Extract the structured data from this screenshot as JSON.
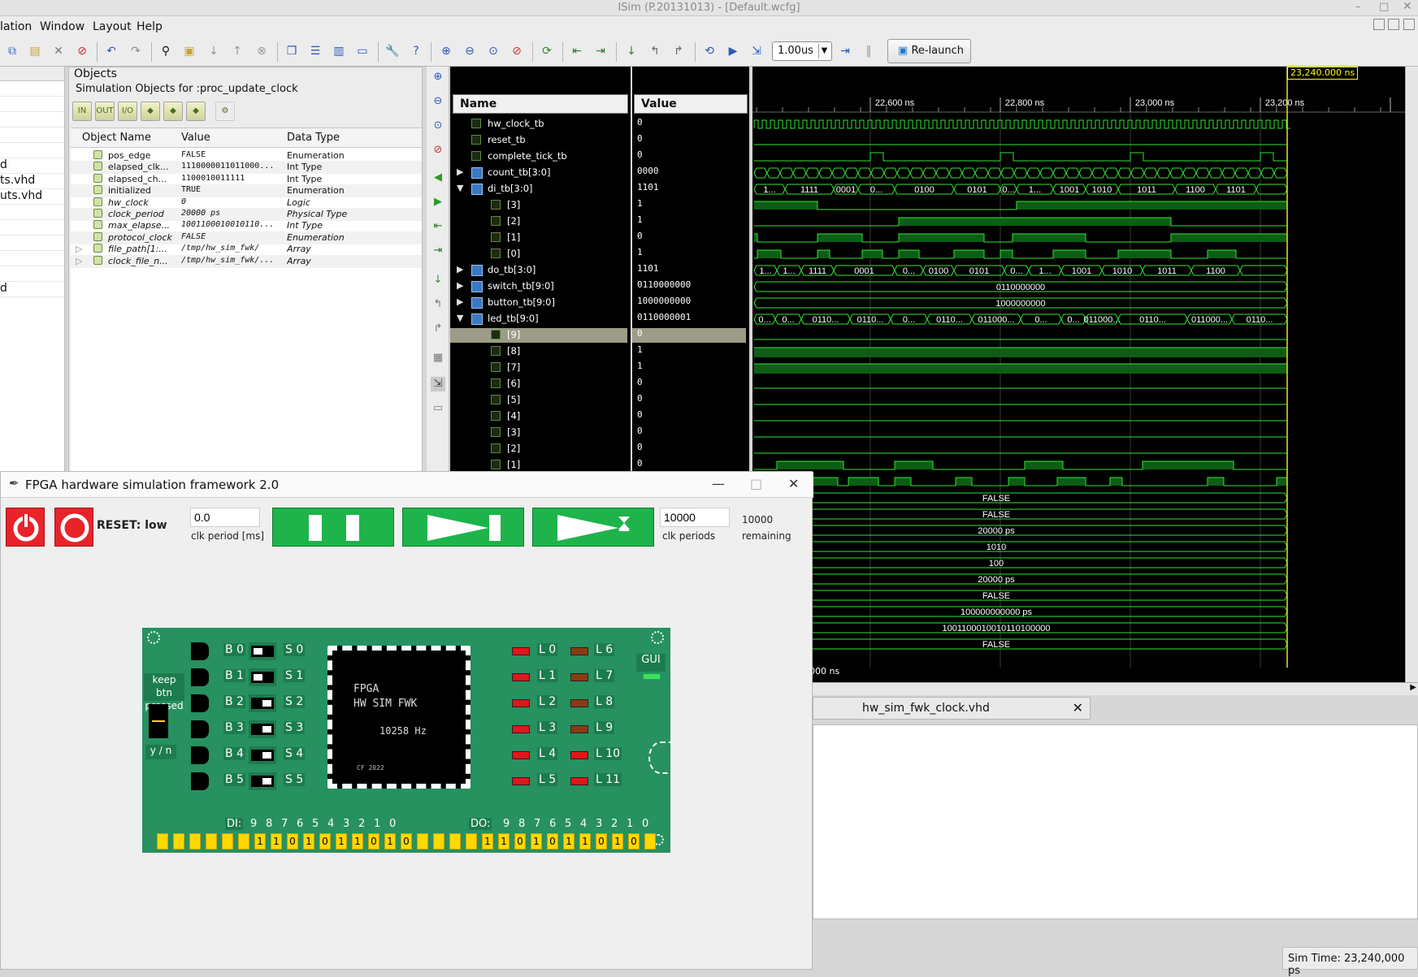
{
  "window": {
    "title": "ISim (P.20131013) - [Default.wcfg]"
  },
  "menu": [
    "lation",
    "Window",
    "Layout",
    "Help"
  ],
  "toolbar": {
    "zoom": "1.00us",
    "relaunch": "Re-launch"
  },
  "left_strip": [
    "",
    "",
    "",
    "",
    "",
    "d",
    "ts.vhd",
    "uts.vhd",
    "",
    "",
    "",
    "",
    "",
    "d"
  ],
  "objects": {
    "title": "Objects",
    "subtitle": "Simulation Objects for :proc_update_clock",
    "columns": [
      "Object Name",
      "Value",
      "Data Type"
    ],
    "rows": [
      {
        "name": "pos_edge",
        "value": "FALSE",
        "type": "Enumeration",
        "italic": false
      },
      {
        "name": "elapsed_clk...",
        "value": "1110000011011000...",
        "type": "Int Type",
        "italic": false
      },
      {
        "name": "elapsed_ch...",
        "value": "1100010011111",
        "type": "Int Type",
        "italic": false
      },
      {
        "name": "initialized",
        "value": "TRUE",
        "type": "Enumeration",
        "italic": false
      },
      {
        "name": "hw_clock",
        "value": "0",
        "type": "Logic",
        "italic": true
      },
      {
        "name": "clock_period",
        "value": "20000 ps",
        "type": "Physical Type",
        "italic": true
      },
      {
        "name": "max_elapse...",
        "value": "1001100010010110...",
        "type": "Int Type",
        "italic": true
      },
      {
        "name": "protocol_clock",
        "value": "FALSE",
        "type": "Enumeration",
        "italic": true
      },
      {
        "name": "file_path[1:...",
        "value": "/tmp/hw_sim_fwk/",
        "type": "Array",
        "italic": true
      },
      {
        "name": "clock_file_n...",
        "value": "/tmp/hw_sim_fwk/...",
        "type": "Array",
        "italic": true
      }
    ]
  },
  "wave": {
    "name_header": "Name",
    "value_header": "Value",
    "signals": [
      {
        "name": "hw_clock_tb",
        "value": "0",
        "indent": 0,
        "tri": ""
      },
      {
        "name": "reset_tb",
        "value": "0",
        "indent": 0,
        "tri": ""
      },
      {
        "name": "complete_tick_tb",
        "value": "0",
        "indent": 0,
        "tri": ""
      },
      {
        "name": "count_tb[3:0]",
        "value": "0000",
        "indent": 0,
        "tri": "▶"
      },
      {
        "name": "di_tb[3:0]",
        "value": "1101",
        "indent": 0,
        "tri": "▼"
      },
      {
        "name": "[3]",
        "value": "1",
        "indent": 1,
        "tri": ""
      },
      {
        "name": "[2]",
        "value": "1",
        "indent": 1,
        "tri": ""
      },
      {
        "name": "[1]",
        "value": "0",
        "indent": 1,
        "tri": ""
      },
      {
        "name": "[0]",
        "value": "1",
        "indent": 1,
        "tri": ""
      },
      {
        "name": "do_tb[3:0]",
        "value": "1101",
        "indent": 0,
        "tri": "▶"
      },
      {
        "name": "switch_tb[9:0]",
        "value": "0110000000",
        "indent": 0,
        "tri": "▶"
      },
      {
        "name": "button_tb[9:0]",
        "value": "1000000000",
        "indent": 0,
        "tri": "▶"
      },
      {
        "name": "led_tb[9:0]",
        "value": "0110000001",
        "indent": 0,
        "tri": "▼"
      },
      {
        "name": "[9]",
        "value": "0",
        "indent": 1,
        "tri": ""
      },
      {
        "name": "[8]",
        "value": "1",
        "indent": 1,
        "tri": ""
      },
      {
        "name": "[7]",
        "value": "1",
        "indent": 1,
        "tri": ""
      },
      {
        "name": "[6]",
        "value": "0",
        "indent": 1,
        "tri": ""
      },
      {
        "name": "[5]",
        "value": "0",
        "indent": 1,
        "tri": ""
      },
      {
        "name": "[4]",
        "value": "0",
        "indent": 1,
        "tri": ""
      },
      {
        "name": "[3]",
        "value": "0",
        "indent": 1,
        "tri": ""
      },
      {
        "name": "[2]",
        "value": "0",
        "indent": 1,
        "tri": ""
      },
      {
        "name": "[1]",
        "value": "0",
        "indent": 1,
        "tri": ""
      }
    ],
    "time_ticks": [
      "22,600 ns",
      "22,800 ns",
      "23,000 ns",
      "23,200 ns",
      "23,4"
    ],
    "cursor": "23,240.000 ns",
    "bus_labels_count": [
      "1...",
      "1111",
      "0001",
      "0...",
      "0100",
      "0101",
      "0...",
      "1...",
      "1001",
      "1010",
      "1011",
      "1100",
      "1101"
    ],
    "bus_labels_do": [
      "1...",
      "1...",
      "1111",
      "0001",
      "0...",
      "0100",
      "0101",
      "0...",
      "1...",
      "1001",
      "1010",
      "1011",
      "1100"
    ],
    "bus_labels_led": [
      "0...",
      "0...",
      "0110...",
      "0110...",
      "0...",
      "0110...",
      "011000...",
      "0...",
      "0...",
      "011000...",
      "0110...",
      "011000...",
      "0110..."
    ],
    "switch_value": "0110000000",
    "button_value": "1000000000",
    "lower_values": [
      "FALSE",
      "FALSE",
      "20000 ps",
      "1010",
      "100",
      "20000 ps",
      "FALSE",
      "100000000000 ps",
      "1001100010010110100000",
      "FALSE"
    ],
    "footer_time": "000 ns"
  },
  "editor": {
    "tab": "hw_sim_fwk_clock.vhd"
  },
  "status": {
    "sim_time": "Sim Time: 23,240,000 ps"
  },
  "fpga": {
    "title": "FPGA hardware simulation framework 2.0",
    "reset_label": "RESET: low",
    "clk_period_value": "0.0",
    "clk_period_label": "clk period [ms]",
    "clk_periods_value": "10000",
    "clk_periods_label": "clk periods",
    "remaining_value": "10000",
    "remaining_label": "remaining",
    "board": {
      "chip_line1": "FPGA",
      "chip_line2": "HW SIM FWK",
      "freq": "10258 Hz",
      "copyright": "CF 2022",
      "keep_btn": "keep btn pressed",
      "yn": "y / n",
      "gui": "GUI",
      "buttons": [
        "B 0",
        "B 1",
        "B 2",
        "B 3",
        "B 4",
        "B 5"
      ],
      "switches": [
        "S 0",
        "S 1",
        "S 2",
        "S 3",
        "S 4",
        "S 5"
      ],
      "leds_left": [
        "L 0",
        "L 1",
        "L 2",
        "L 3",
        "L 4",
        "L 5"
      ],
      "leds_right": [
        "L 6",
        "L 7",
        "L 8",
        "L 9",
        "L 10",
        "L 11"
      ],
      "di_label": "DI:",
      "do_label": "DO:",
      "bit_index": [
        "9",
        "8",
        "7",
        "6",
        "5",
        "4",
        "3",
        "2",
        "1",
        "0"
      ],
      "di_bits": [
        "1",
        "1",
        "0",
        "1",
        "0",
        "1",
        "1",
        "0",
        "1",
        "0"
      ],
      "do_bits": [
        "1",
        "1",
        "0",
        "1",
        "0",
        "1",
        "1",
        "0",
        "1",
        "0"
      ],
      "led_on_color": "#e4141a",
      "led_off_color": "#8c3a12"
    }
  }
}
